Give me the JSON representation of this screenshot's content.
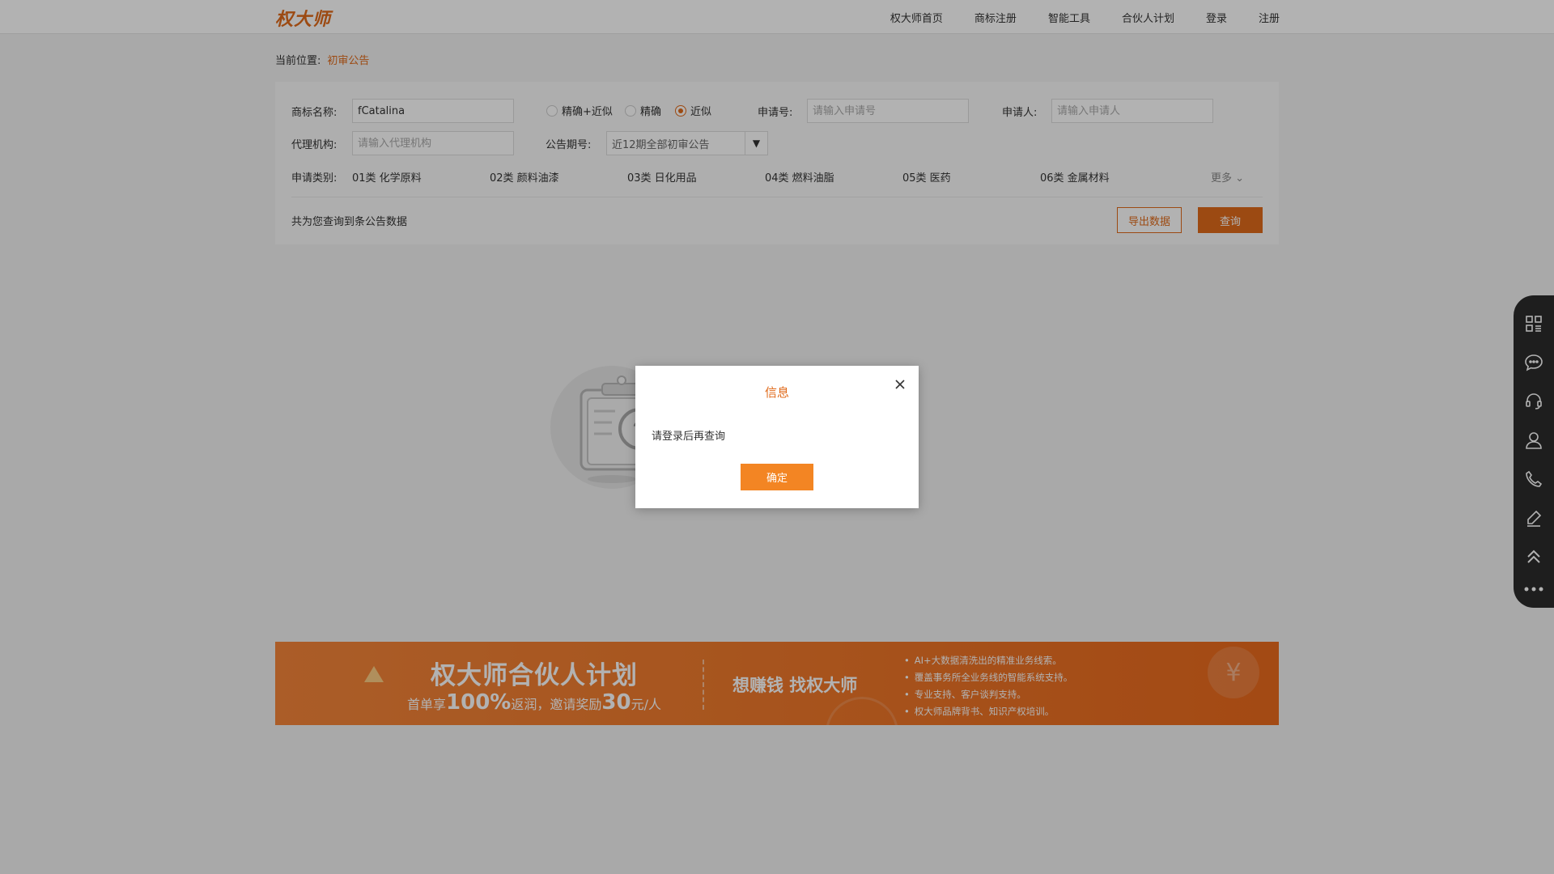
{
  "header": {
    "logo": "权大师",
    "nav": [
      "权大师首页",
      "商标注册",
      "智能工具",
      "合伙人计划",
      "登录",
      "注册"
    ]
  },
  "breadcrumb": {
    "label": "当前位置:",
    "current": "初审公告"
  },
  "search": {
    "trademark_label": "商标名称:",
    "trademark_value": "fCatalina",
    "match_modes": [
      {
        "label": "精确+近似",
        "selected": false
      },
      {
        "label": "精确",
        "selected": false
      },
      {
        "label": "近似",
        "selected": true
      }
    ],
    "app_no_label": "申请号:",
    "app_no_placeholder": "请输入申请号",
    "applicant_label": "申请人:",
    "applicant_placeholder": "请输入申请人",
    "agency_label": "代理机构:",
    "agency_placeholder": "请输入代理机构",
    "issue_label": "公告期号:",
    "issue_value": "近12期全部初审公告",
    "category_label": "申请类别:",
    "categories": [
      "01类 化学原料",
      "02类 颜料油漆",
      "03类 日化用品",
      "04类 燃料油脂",
      "05类 医药",
      "06类 金属材料"
    ],
    "more_label": "更多",
    "result_text": "共为您查询到条公告数据",
    "export_button": "导出数据",
    "query_button": "查询"
  },
  "banner": {
    "title": "权大师合伙人计划",
    "sub_prefix": "首单享",
    "sub_percent": "100%",
    "sub_middle": "返润，邀请奖励",
    "sub_amount": "30",
    "sub_suffix": "元/人",
    "slogan": "想赚钱  找权大师",
    "bullets": [
      "AI+大数据清洗出的精准业务线索。",
      "覆盖事务所全业务线的智能系统支持。",
      "专业支持、客户谈判支持。",
      "权大师品牌背书、知识产权培训。"
    ]
  },
  "sidebar_icons": [
    "qrcode-icon",
    "chat-icon",
    "headset-icon",
    "user-icon",
    "phone-icon",
    "edit-icon",
    "back-to-top-icon",
    "more-icon"
  ],
  "modal": {
    "title": "信息",
    "message": "请登录后再查询",
    "ok_button": "确定"
  },
  "colors": {
    "accent": "#e06a1a",
    "modal_button": "#f38523",
    "sidebar": "#2b2b2b"
  }
}
